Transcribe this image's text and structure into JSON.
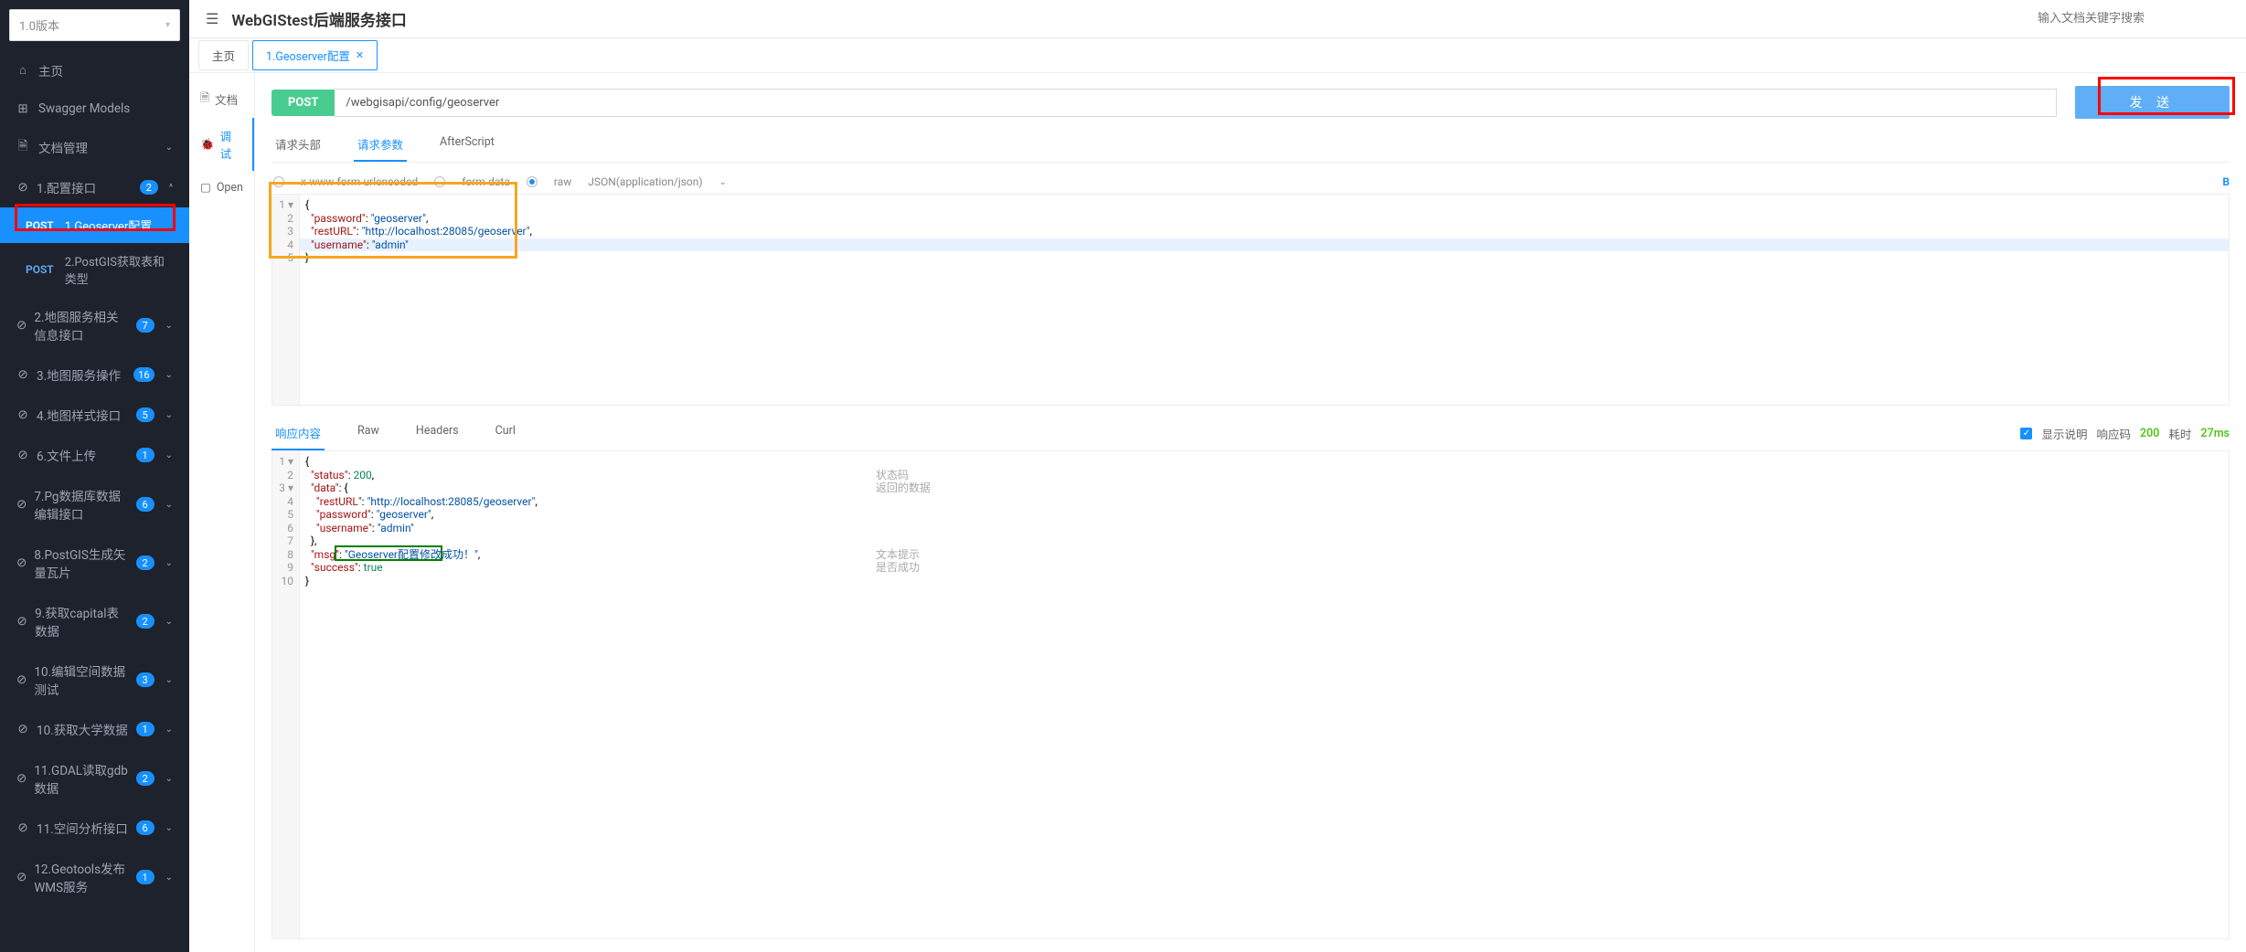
{
  "version": "1.0版本",
  "nav": {
    "home": "主页",
    "swagger": "Swagger Models",
    "docmgmt": "文档管理",
    "section1": {
      "label": "1.配置接口",
      "count": "2"
    },
    "sub1": {
      "method": "POST",
      "label": "1.Geoserver配置"
    },
    "sub2": {
      "method": "POST",
      "label": "2.PostGIS获取表和类型"
    },
    "section2": {
      "label": "2.地图服务相关信息接口",
      "count": "7"
    },
    "section3": {
      "label": "3.地图服务操作",
      "count": "16"
    },
    "section4": {
      "label": "4.地图样式接口",
      "count": "5"
    },
    "section6": {
      "label": "6.文件上传",
      "count": "1"
    },
    "section7": {
      "label": "7.Pg数据库数据编辑接口",
      "count": "6"
    },
    "section8": {
      "label": "8.PostGIS生成矢量瓦片",
      "count": "2"
    },
    "section9": {
      "label": "9.获取capital表数据",
      "count": "2"
    },
    "section10a": {
      "label": "10.编辑空间数据测试",
      "count": "3"
    },
    "section10b": {
      "label": "10.获取大学数据",
      "count": "1"
    },
    "section11a": {
      "label": "11.GDAL读取gdb数据",
      "count": "2"
    },
    "section11b": {
      "label": "11.空间分析接口",
      "count": "6"
    },
    "section12": {
      "label": "12.Geotools发布WMS服务",
      "count": "1"
    }
  },
  "header": {
    "title": "WebGIStest后端服务接口",
    "search_placeholder": "输入文档关键字搜索"
  },
  "tabs": {
    "home": "主页",
    "t1": "1.Geoserver配置"
  },
  "mini": {
    "doc": "文档",
    "debug": "调试",
    "open": "Open"
  },
  "request": {
    "method": "POST",
    "url": "/webgisapi/config/geoserver",
    "send": "发 送",
    "tab_headers": "请求头部",
    "tab_params": "请求参数",
    "tab_after": "AfterScript",
    "bt_form": "x-www-form-urlencoded",
    "bt_fd": "form-data",
    "bt_raw": "raw",
    "bt_json": "JSON(application/json)",
    "code": {
      "l1": "{",
      "l2a": "\"password\"",
      "l2b": ": ",
      "l2c": "\"geoserver\"",
      "l2d": ",",
      "l3a": "\"restURL\"",
      "l3b": ": ",
      "l3c": "\"http://localhost:28085/geoserver\"",
      "l3d": ",",
      "l4a": "\"username\"",
      "l4b": ": ",
      "l4c": "\"admin\"",
      "l5": "}"
    }
  },
  "response": {
    "tab_body": "响应内容",
    "tab_raw": "Raw",
    "tab_headers": "Headers",
    "tab_curl": "Curl",
    "show_desc": "显示说明",
    "status_label": "响应码",
    "status_code": "200",
    "time_label": "耗时",
    "time_value": "27ms",
    "code": {
      "l1": "{",
      "l2a": "\"status\"",
      "l2b": ": ",
      "l2c": "200",
      "l2d": ",",
      "l3a": "\"data\"",
      "l3b": ": {",
      "l4a": "\"restURL\"",
      "l4b": ": ",
      "l4c": "\"http://localhost:28085/geoserver\"",
      "l4d": ",",
      "l5a": "\"password\"",
      "l5b": ": ",
      "l5c": "\"geoserver\"",
      "l5d": ",",
      "l6a": "\"username\"",
      "l6b": ": ",
      "l6c": "\"admin\"",
      "l7": "},",
      "l8a": "\"msg\"",
      "l8b": ": ",
      "l8c": "\"Geoserver配置修改成功！\"",
      "l8d": ",",
      "l9a": "\"success\"",
      "l9b": ": ",
      "l9c": "true",
      "l10": "}"
    },
    "desc": {
      "d1": "状态码",
      "d2": "返回的数据",
      "d3": "文本提示",
      "d4": "是否成功"
    }
  }
}
